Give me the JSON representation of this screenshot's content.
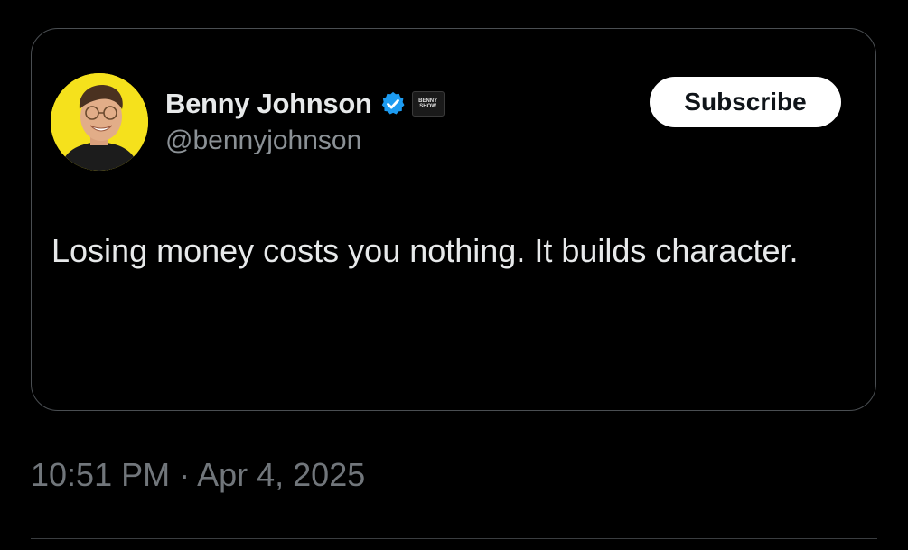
{
  "quoted_post": {
    "author": {
      "display_name": "Benny Johnson",
      "handle": "@bennyjohnson",
      "verified_icon": "verified-badge-icon",
      "affiliate_badge_text": "BENNY SHOW"
    },
    "subscribe_label": "Subscribe",
    "text": "Losing money costs you nothing. It builds character."
  },
  "timestamp": "10:51 PM · Apr 4, 2025",
  "colors": {
    "background": "#000000",
    "text_primary": "#e7e9ea",
    "text_secondary": "#71767b",
    "verified_blue": "#1d9bf0",
    "avatar_bg": "#f5e11c",
    "subscribe_bg": "#ffffff"
  }
}
